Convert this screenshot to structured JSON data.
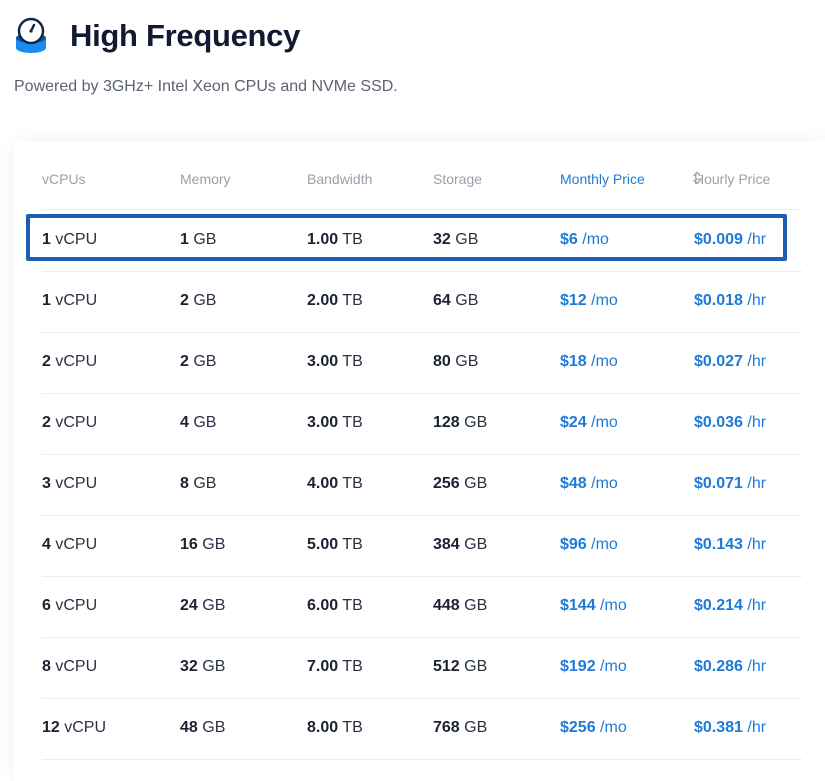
{
  "header": {
    "title": "High Frequency",
    "subtitle": "Powered by 3GHz+ Intel Xeon CPUs and NVMe SSD."
  },
  "table": {
    "columns": [
      {
        "key": "vcpus",
        "label": "vCPUs"
      },
      {
        "key": "memory",
        "label": "Memory"
      },
      {
        "key": "bandwidth",
        "label": "Bandwidth"
      },
      {
        "key": "storage",
        "label": "Storage"
      },
      {
        "key": "monthly",
        "label": "Monthly Price",
        "sorted": true
      },
      {
        "key": "hourly",
        "label": "Hourly Price"
      }
    ],
    "rows": [
      {
        "vcpus": [
          "1",
          " vCPU"
        ],
        "memory": [
          "1",
          " GB"
        ],
        "bandwidth": [
          "1.00",
          " TB"
        ],
        "storage": [
          "32",
          " GB"
        ],
        "monthly": [
          "$6",
          " /mo"
        ],
        "hourly": [
          "$0.009",
          " /hr"
        ],
        "selected": true
      },
      {
        "vcpus": [
          "1",
          " vCPU"
        ],
        "memory": [
          "2",
          " GB"
        ],
        "bandwidth": [
          "2.00",
          " TB"
        ],
        "storage": [
          "64",
          " GB"
        ],
        "monthly": [
          "$12",
          " /mo"
        ],
        "hourly": [
          "$0.018",
          " /hr"
        ]
      },
      {
        "vcpus": [
          "2",
          " vCPU"
        ],
        "memory": [
          "2",
          " GB"
        ],
        "bandwidth": [
          "3.00",
          " TB"
        ],
        "storage": [
          "80",
          " GB"
        ],
        "monthly": [
          "$18",
          " /mo"
        ],
        "hourly": [
          "$0.027",
          " /hr"
        ]
      },
      {
        "vcpus": [
          "2",
          " vCPU"
        ],
        "memory": [
          "4",
          " GB"
        ],
        "bandwidth": [
          "3.00",
          " TB"
        ],
        "storage": [
          "128",
          " GB"
        ],
        "monthly": [
          "$24",
          " /mo"
        ],
        "hourly": [
          "$0.036",
          " /hr"
        ]
      },
      {
        "vcpus": [
          "3",
          " vCPU"
        ],
        "memory": [
          "8",
          " GB"
        ],
        "bandwidth": [
          "4.00",
          " TB"
        ],
        "storage": [
          "256",
          " GB"
        ],
        "monthly": [
          "$48",
          " /mo"
        ],
        "hourly": [
          "$0.071",
          " /hr"
        ]
      },
      {
        "vcpus": [
          "4",
          " vCPU"
        ],
        "memory": [
          "16",
          " GB"
        ],
        "bandwidth": [
          "5.00",
          " TB"
        ],
        "storage": [
          "384",
          " GB"
        ],
        "monthly": [
          "$96",
          " /mo"
        ],
        "hourly": [
          "$0.143",
          " /hr"
        ]
      },
      {
        "vcpus": [
          "6",
          " vCPU"
        ],
        "memory": [
          "24",
          " GB"
        ],
        "bandwidth": [
          "6.00",
          " TB"
        ],
        "storage": [
          "448",
          " GB"
        ],
        "monthly": [
          "$144",
          " /mo"
        ],
        "hourly": [
          "$0.214",
          " /hr"
        ]
      },
      {
        "vcpus": [
          "8",
          " vCPU"
        ],
        "memory": [
          "32",
          " GB"
        ],
        "bandwidth": [
          "7.00",
          " TB"
        ],
        "storage": [
          "512",
          " GB"
        ],
        "monthly": [
          "$192",
          " /mo"
        ],
        "hourly": [
          "$0.286",
          " /hr"
        ]
      },
      {
        "vcpus": [
          "12",
          " vCPU"
        ],
        "memory": [
          "48",
          " GB"
        ],
        "bandwidth": [
          "8.00",
          " TB"
        ],
        "storage": [
          "768",
          " GB"
        ],
        "monthly": [
          "$256",
          " /mo"
        ],
        "hourly": [
          "$0.381",
          " /hr"
        ]
      }
    ]
  },
  "icons": {
    "header": "high-frequency-icon",
    "sort": "sort-icon"
  },
  "colors": {
    "accent": "#1e7ad6",
    "highlight": "#1e5db5",
    "title": "#121a33",
    "muted": "#9aa0ab"
  }
}
